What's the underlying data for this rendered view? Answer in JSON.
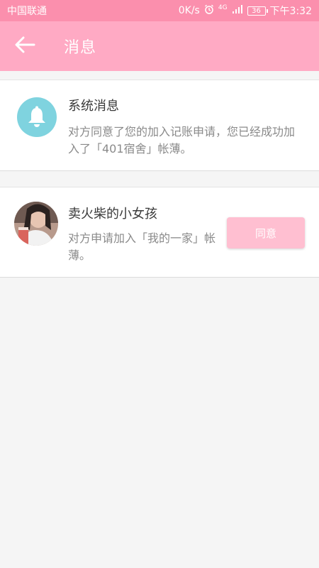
{
  "status_bar": {
    "carrier": "中国联通",
    "speed": "0K/s",
    "network": "4G",
    "battery": "36",
    "time": "下午3:32"
  },
  "header": {
    "title": "消息"
  },
  "messages": [
    {
      "title": "系统消息",
      "body": "对方同意了您的加入记账申请，您已经成功加入了「401宿舍」帐薄。",
      "icon": "bell-icon"
    },
    {
      "title": "卖火柴的小女孩",
      "body": "对方申请加入「我的一家」帐薄。",
      "action_label": "同意"
    }
  ],
  "colors": {
    "status_bar": "#fb8fad",
    "header": "#ffaac4",
    "bell_bg": "#7fd3df",
    "button_bg": "#ffbfd1"
  }
}
